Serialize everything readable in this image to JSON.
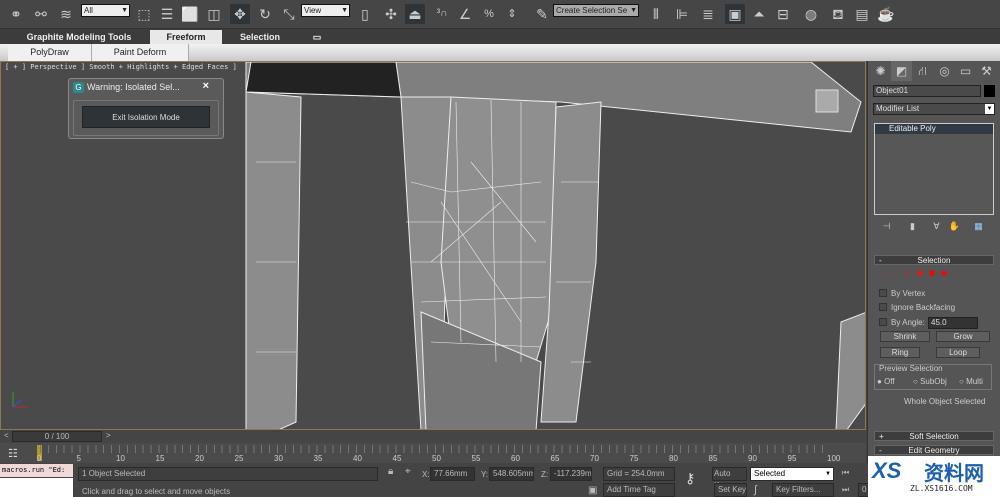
{
  "toolbar": {
    "filter_dropdown": "All",
    "refcoord_dropdown": "View",
    "named_selection": "Create Selection Se",
    "icons": [
      "link-icon",
      "unlink-icon",
      "bind-spacewarp-icon",
      "select-object-icon",
      "select-by-name-icon",
      "rect-selection-icon",
      "window-crossing-icon",
      "move-icon",
      "rotate-icon",
      "scale-icon",
      "pivot-icon",
      "manipulate-icon",
      "keyboard-shortcut-icon",
      "snap-3d-icon",
      "angle-snap-icon",
      "percent-snap-icon",
      "spinner-snap-icon",
      "edit-named-sets-icon",
      "mirror-icon",
      "align-icon",
      "layer-manager-icon",
      "graphite-toggle-icon",
      "curve-editor-icon",
      "schematic-view-icon",
      "material-editor-icon",
      "render-setup-icon",
      "rendered-frame-icon",
      "render-icon"
    ]
  },
  "ribbon": {
    "tabs": [
      "Graphite Modeling Tools",
      "Freeform",
      "Selection"
    ],
    "active_tab": "Freeform",
    "panels": [
      "PolyDraw",
      "Paint Deform"
    ]
  },
  "viewport": {
    "label": "[ + ] Perspective ] Smooth + Highlights + Edged Faces ]"
  },
  "dialog": {
    "title": "Warning: Isolated Sel...",
    "close": "×",
    "button": "Exit Isolation Mode"
  },
  "command_panel": {
    "tabs": [
      "create-icon",
      "modify-icon",
      "hierarchy-icon",
      "motion-icon",
      "display-icon",
      "utilities-icon"
    ],
    "object_name": "Object01",
    "object_color": "#000000",
    "modifier_list": "Modifier List",
    "stack": [
      "Editable Poly"
    ],
    "selection": {
      "header": "Selection",
      "by_vertex": "By Vertex",
      "ignore_backfacing": "Ignore Backfacing",
      "by_angle": "By Angle:",
      "angle_value": "45.0",
      "shrink": "Shrink",
      "grow": "Grow",
      "ring": "Ring",
      "loop": "Loop",
      "preview_label": "Preview Selection",
      "preview_options": [
        "Off",
        "SubObj",
        "Multi"
      ],
      "preview_selected": "Off",
      "status": "Whole Object Selected"
    },
    "soft_selection": "Soft Selection",
    "edit_geometry": "Edit Geometry"
  },
  "timeline": {
    "frame": "0 / 100",
    "prev": "<",
    "next": ">",
    "ticks": [
      "0",
      "5",
      "10",
      "15",
      "20",
      "25",
      "30",
      "35",
      "40",
      "45",
      "50",
      "55",
      "60",
      "65",
      "70",
      "75",
      "80",
      "85",
      "90",
      "95",
      "100"
    ]
  },
  "status": {
    "maxscript": "macros.run \"Ed:",
    "selection": "1 Object Selected",
    "prompt": "Click and drag to select and move objects",
    "x_label": "X:",
    "x": "77.66mm",
    "y_label": "Y:",
    "y": "548.605mm",
    "z_label": "Z:",
    "z": "-117.239mm",
    "grid": "Grid = 254.0mm",
    "add_time_tag": "Add Time Tag",
    "auto_key": "Auto Key",
    "set_key": "Set Key",
    "key_mode": "Selected",
    "key_filters": "Key Filters...",
    "frame_field": "0"
  },
  "watermark": {
    "text": "资料网",
    "url_text": "ZL.XS1616.COM"
  },
  "colors": {
    "viewport_bg": "#4a4a4a",
    "mesh": "#8c8c8c",
    "selection_red": "#e00000"
  }
}
